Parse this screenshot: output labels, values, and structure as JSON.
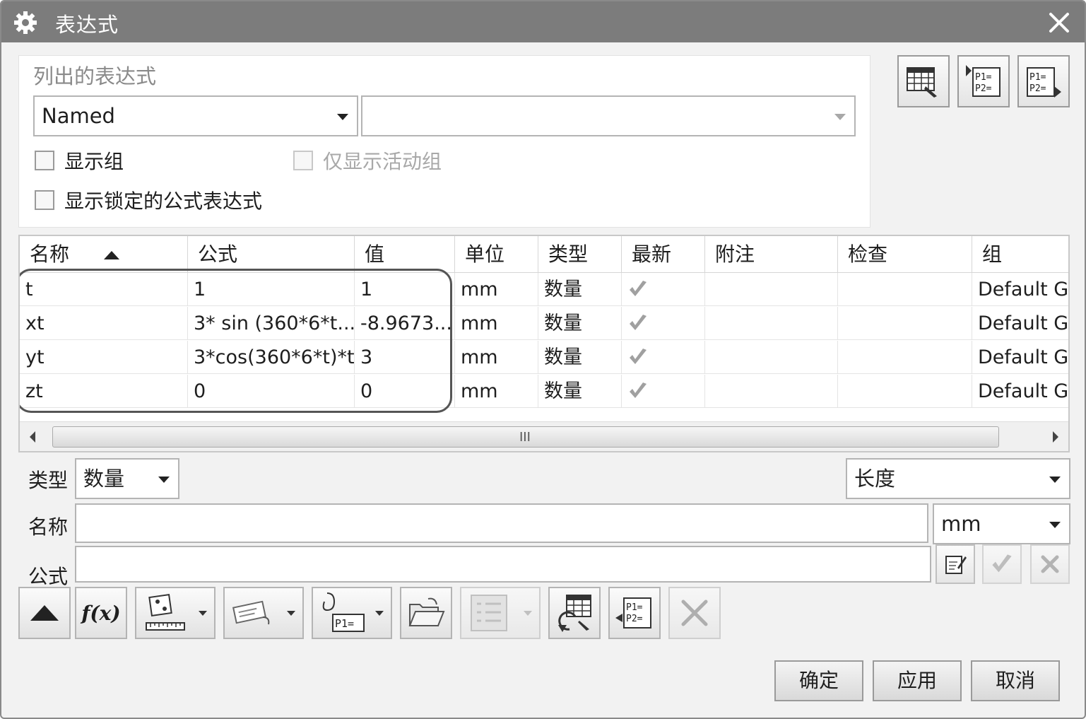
{
  "window": {
    "title": "表达式",
    "icons": {
      "settings": "gear-icon",
      "close": "close-icon"
    }
  },
  "listed_expressions": {
    "section_label": "列出的表达式",
    "filter_combo": {
      "value": "Named"
    },
    "second_combo": {
      "value": ""
    },
    "checkboxes": {
      "show_groups": {
        "label": "显示组",
        "checked": false
      },
      "active_group_only": {
        "label": "仅显示活动组",
        "checked": false,
        "enabled": false
      },
      "show_locked": {
        "label": "显示锁定的公式表达式",
        "checked": false
      }
    }
  },
  "top_right_icons": [
    "spreadsheet-edit-icon",
    "import-expressions-icon",
    "export-expressions-icon"
  ],
  "table": {
    "columns": [
      "名称",
      "公式",
      "值",
      "单位",
      "类型",
      "最新",
      "附注",
      "检查",
      "组"
    ],
    "rows": [
      {
        "name": "t",
        "formula": "1",
        "value": "1",
        "unit": "mm",
        "type": "数量",
        "uptodate": true,
        "note": "",
        "check": "",
        "group": "Default G"
      },
      {
        "name": "xt",
        "formula": "3* sin (360*6*t...",
        "value": "-8.9673...",
        "unit": "mm",
        "type": "数量",
        "uptodate": true,
        "note": "",
        "check": "",
        "group": "Default G"
      },
      {
        "name": "yt",
        "formula": "3*cos(360*6*t)*t",
        "value": "3",
        "unit": "mm",
        "type": "数量",
        "uptodate": true,
        "note": "",
        "check": "",
        "group": "Default G"
      },
      {
        "name": "zt",
        "formula": "0",
        "value": "0",
        "unit": "mm",
        "type": "数量",
        "uptodate": true,
        "note": "",
        "check": "",
        "group": "Default G"
      }
    ],
    "scroll_grip": "III"
  },
  "editor": {
    "type_label": "类型",
    "type_value": "数量",
    "dimension_value": "长度",
    "name_label": "名称",
    "name_value": "",
    "unit_value": "mm",
    "formula_label": "公式",
    "formula_value": ""
  },
  "toolbar": {
    "icons": [
      "collapse-up-icon",
      "function-icon",
      "measure-icon",
      "functions-list-icon",
      "reference-icon",
      "open-folder-icon",
      "list-icon",
      "spreadsheet-refresh-icon",
      "create-interpart-icon",
      "delete-icon"
    ],
    "fx_label": "f(x)"
  },
  "actions": {
    "ok": "确定",
    "apply": "应用",
    "cancel": "取消"
  },
  "colors": {
    "titlebar": "#7c7c7c",
    "dialog_bg": "#f2f2f2",
    "highlight": "#555555"
  }
}
